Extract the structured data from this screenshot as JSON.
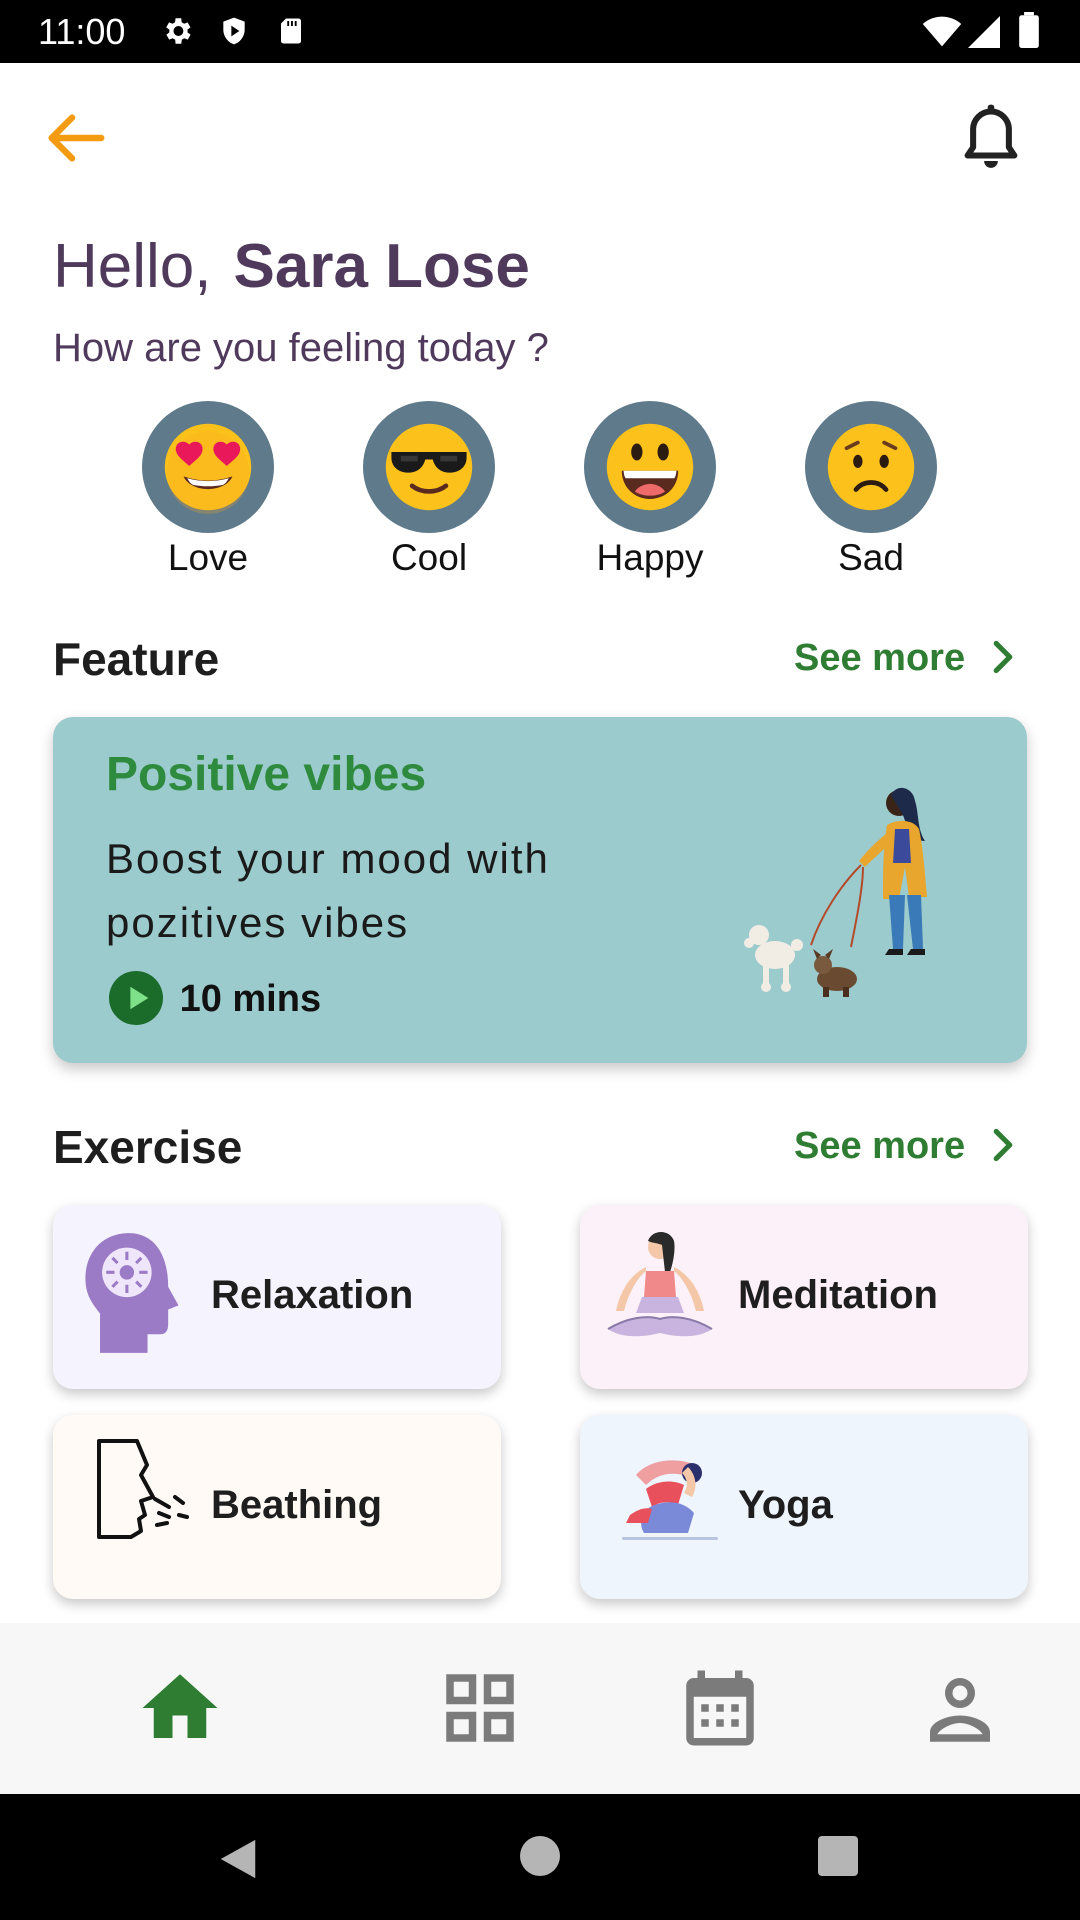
{
  "status_bar": {
    "time": "11:00",
    "icons": [
      "gear-icon",
      "shield-icon",
      "sd-card-icon",
      "wifi-icon",
      "signal-icon",
      "battery-icon"
    ]
  },
  "header": {
    "back_icon": "arrow-left-icon",
    "notification_icon": "bell-icon",
    "accent_color": "#f39c12"
  },
  "greeting": {
    "hello": "Hello,",
    "name": "Sara Lose",
    "question": "How are you feeling today ?"
  },
  "moods": [
    {
      "label": "Love",
      "icon": "heart-eyes-emoji"
    },
    {
      "label": "Cool",
      "icon": "sunglasses-emoji"
    },
    {
      "label": "Happy",
      "icon": "grinning-emoji"
    },
    {
      "label": "Sad",
      "icon": "worried-emoji"
    }
  ],
  "feature": {
    "section_title": "Feature",
    "see_more": "See more",
    "card": {
      "title": "Positive vibes",
      "description": "Boost your mood with pozitives vibes",
      "duration": "10 mins",
      "background": "#9bcbcd"
    }
  },
  "exercise": {
    "section_title": "Exercise",
    "see_more": "See more",
    "items": [
      {
        "label": "Relaxation",
        "icon": "head-brain-icon",
        "background": "#f5f3fd"
      },
      {
        "label": "Meditation",
        "icon": "meditation-icon",
        "background": "#fcf1f8"
      },
      {
        "label": "Beathing",
        "icon": "breathing-icon",
        "background": "#fffaf5"
      },
      {
        "label": "Yoga",
        "icon": "yoga-icon",
        "background": "#eef5fd"
      }
    ]
  },
  "bottom_nav": {
    "items": [
      "home-icon",
      "grid-icon",
      "calendar-icon",
      "profile-icon"
    ],
    "active": "home-icon",
    "active_color": "#2e7d32",
    "inactive_color": "#7b7b7b"
  },
  "colors": {
    "primary_green": "#2e7d32",
    "text_purple": "#4f3a5c"
  }
}
